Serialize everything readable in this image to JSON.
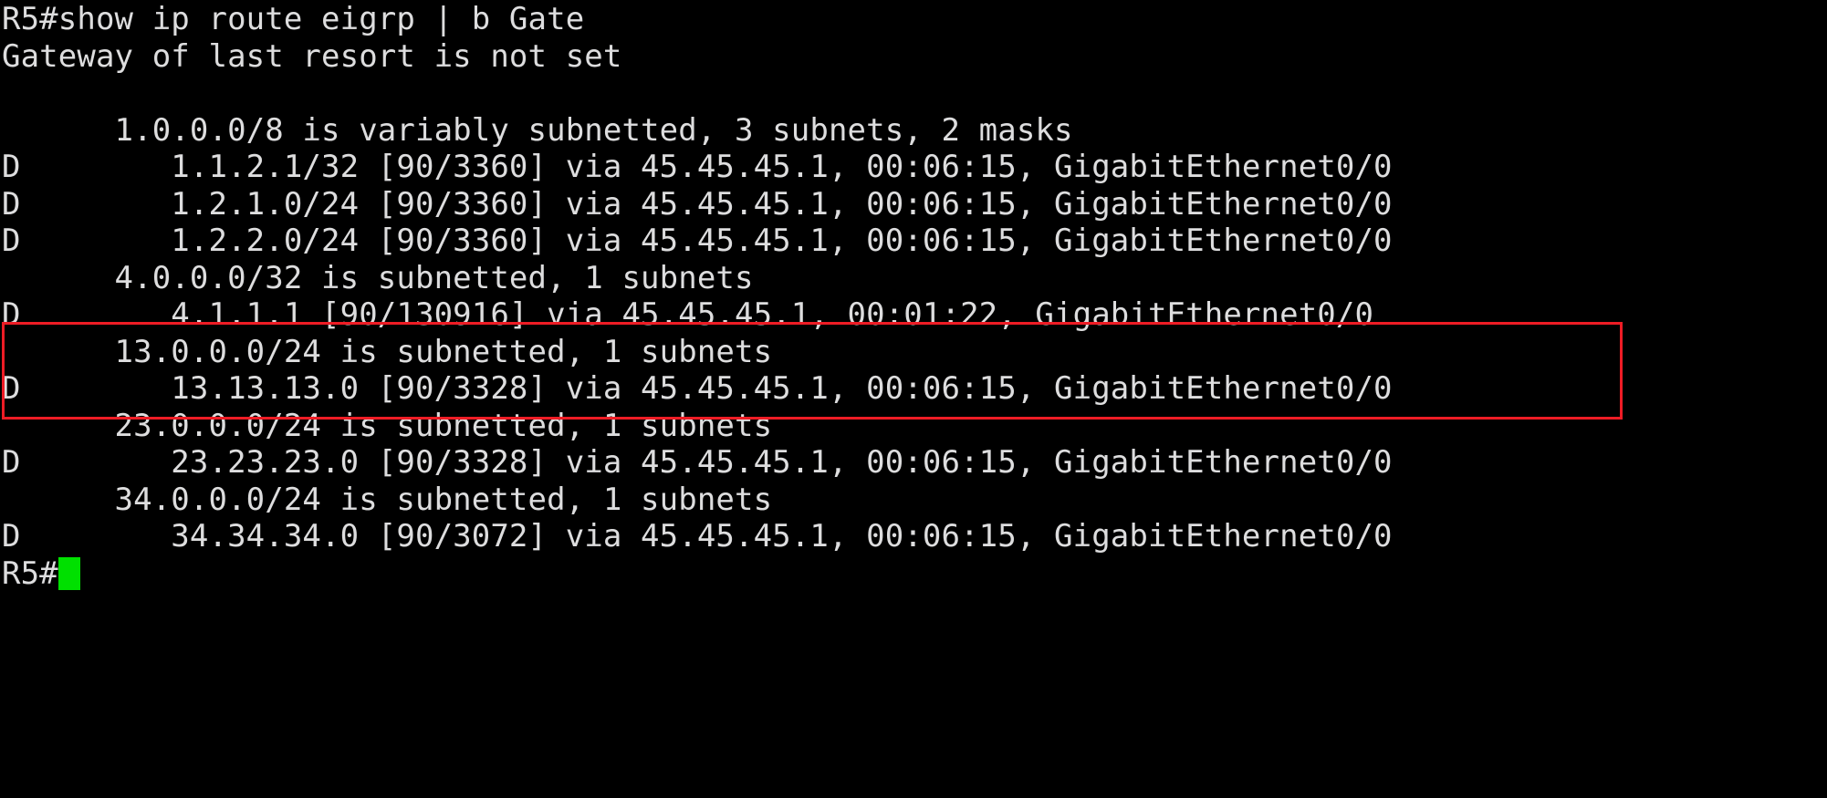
{
  "terminal": {
    "device": "R5",
    "prompt": "R5#",
    "foreground_color": "#ddddde",
    "background_color": "#000000",
    "cursor_color": "#00e000",
    "highlight_color": "#ee1c25",
    "command": "R5#show ip route eigrp | b Gate",
    "lines": [
      "R5#show ip route eigrp | b Gate",
      "Gateway of last resort is not set",
      "",
      "      1.0.0.0/8 is variably subnetted, 3 subnets, 2 masks",
      "D        1.1.2.1/32 [90/3360] via 45.45.45.1, 00:06:15, GigabitEthernet0/0",
      "D        1.2.1.0/24 [90/3360] via 45.45.45.1, 00:06:15, GigabitEthernet0/0",
      "D        1.2.2.0/24 [90/3360] via 45.45.45.1, 00:06:15, GigabitEthernet0/0",
      "      4.0.0.0/32 is subnetted, 1 subnets",
      "D        4.1.1.1 [90/130916] via 45.45.45.1, 00:01:22, GigabitEthernet0/0",
      "      13.0.0.0/24 is subnetted, 1 subnets",
      "D        13.13.13.0 [90/3328] via 45.45.45.1, 00:06:15, GigabitEthernet0/0",
      "      23.0.0.0/24 is subnetted, 1 subnets",
      "D        23.23.23.0 [90/3328] via 45.45.45.1, 00:06:15, GigabitEthernet0/0",
      "      34.0.0.0/24 is subnetted, 1 subnets",
      "D        34.34.34.0 [90/3072] via 45.45.45.1, 00:06:15, GigabitEthernet0/0"
    ],
    "gateway_status": "Gateway of last resort is not set",
    "routes": [
      {
        "code": "D",
        "network": "1.1.2.1/32",
        "metric": "[90/3360]",
        "next_hop": "45.45.45.1",
        "uptime": "00:06:15",
        "interface": "GigabitEthernet0/0"
      },
      {
        "code": "D",
        "network": "1.2.1.0/24",
        "metric": "[90/3360]",
        "next_hop": "45.45.45.1",
        "uptime": "00:06:15",
        "interface": "GigabitEthernet0/0"
      },
      {
        "code": "D",
        "network": "1.2.2.0/24",
        "metric": "[90/3360]",
        "next_hop": "45.45.45.1",
        "uptime": "00:06:15",
        "interface": "GigabitEthernet0/0"
      },
      {
        "code": "D",
        "network": "4.1.1.1",
        "metric": "[90/130916]",
        "next_hop": "45.45.45.1",
        "uptime": "00:01:22",
        "interface": "GigabitEthernet0/0",
        "highlighted": true
      },
      {
        "code": "D",
        "network": "13.13.13.0",
        "metric": "[90/3328]",
        "next_hop": "45.45.45.1",
        "uptime": "00:06:15",
        "interface": "GigabitEthernet0/0"
      },
      {
        "code": "D",
        "network": "23.23.23.0",
        "metric": "[90/3328]",
        "next_hop": "45.45.45.1",
        "uptime": "00:06:15",
        "interface": "GigabitEthernet0/0"
      },
      {
        "code": "D",
        "network": "34.34.34.0",
        "metric": "[90/3072]",
        "next_hop": "45.45.45.1",
        "uptime": "00:06:15",
        "interface": "GigabitEthernet0/0"
      }
    ],
    "subnet_headers": [
      "1.0.0.0/8 is variably subnetted, 3 subnets, 2 masks",
      "4.0.0.0/32 is subnetted, 1 subnets",
      "13.0.0.0/24 is subnetted, 1 subnets",
      "23.0.0.0/24 is subnetted, 1 subnets",
      "34.0.0.0/24 is subnetted, 1 subnets"
    ],
    "final_prompt": "R5#"
  }
}
